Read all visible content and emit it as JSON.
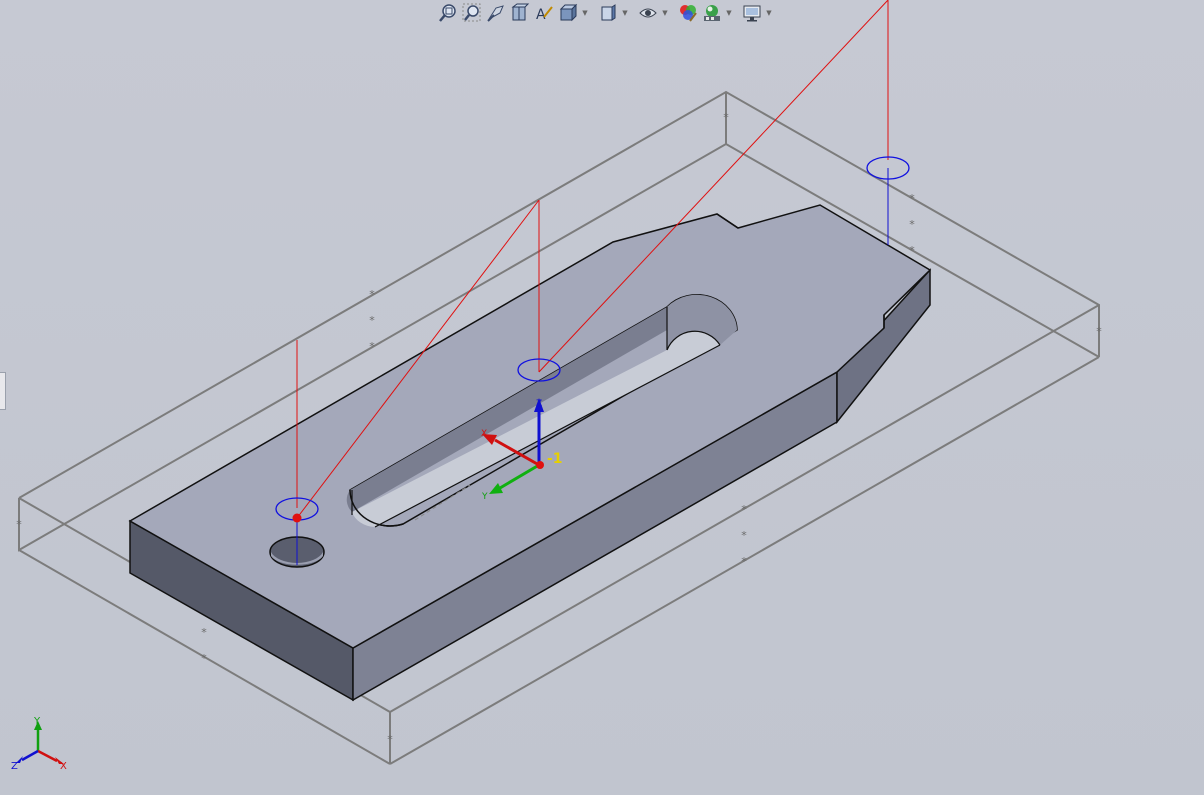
{
  "window": {
    "background": "#c4c8d2"
  },
  "toolbar": {
    "buttons": [
      {
        "name": "zoom-to-fit-icon",
        "dropdown": false
      },
      {
        "name": "zoom-to-area-icon",
        "dropdown": false
      },
      {
        "name": "previous-view-icon",
        "dropdown": false
      },
      {
        "name": "section-view-icon",
        "dropdown": false
      },
      {
        "name": "dynamic-annotation-icon",
        "dropdown": false
      },
      {
        "name": "view-orientation-icon",
        "dropdown": true
      },
      {
        "name": "display-style-icon",
        "dropdown": true
      },
      {
        "name": "hide-show-items-icon",
        "dropdown": true
      },
      {
        "name": "edit-appearance-icon",
        "dropdown": false
      },
      {
        "name": "apply-scene-icon",
        "dropdown": true
      },
      {
        "name": "view-settings-icon",
        "dropdown": true
      }
    ]
  },
  "model": {
    "face_color": "#a4a8ba",
    "side_color": "#7e8294",
    "dark_side_color": "#555968",
    "edge_color": "#111111"
  },
  "triad": {
    "x_label": "X",
    "y_label": "Y",
    "z_label": "Z",
    "x_color": "#d01010",
    "y_color": "#10b010",
    "z_color": "#1010d0",
    "tag": "-1"
  },
  "mini_triad": {
    "x_label": "X",
    "y_label": "Y",
    "z_label": "Z"
  }
}
